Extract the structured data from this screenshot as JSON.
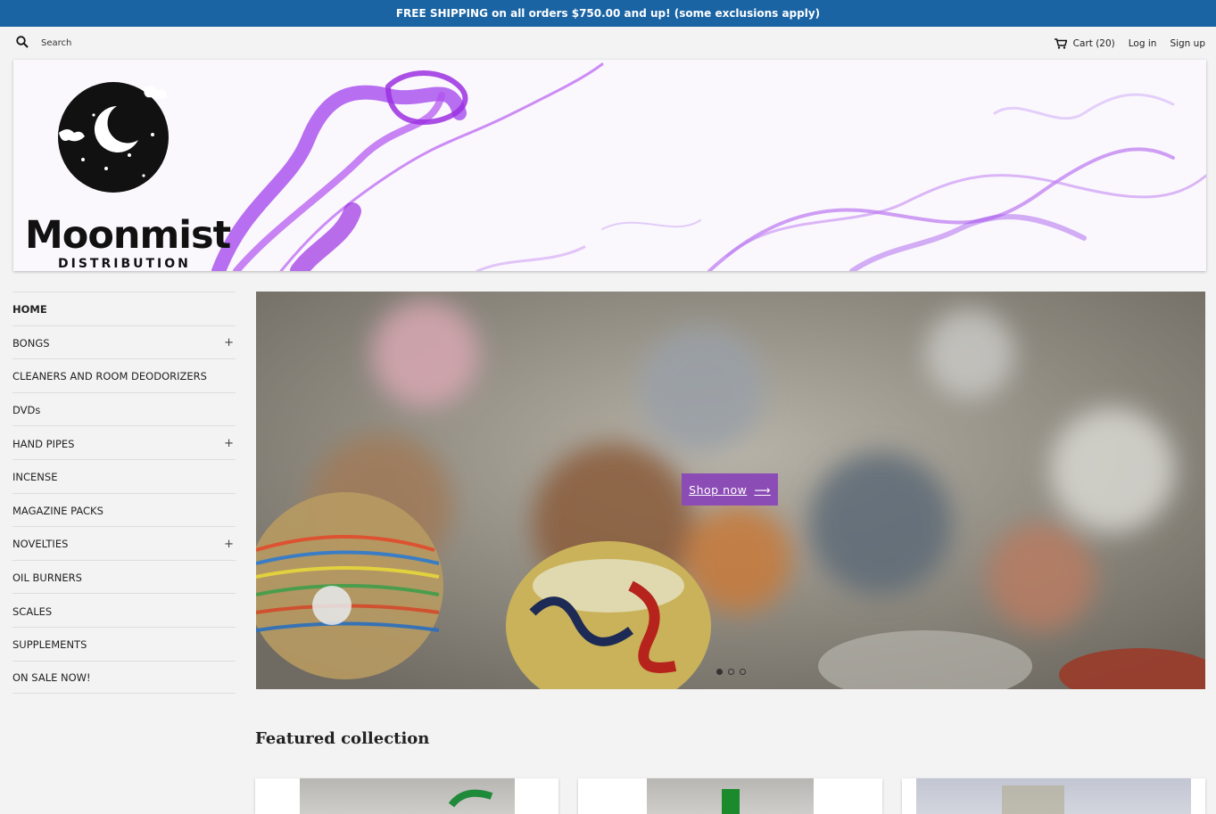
{
  "announcement": "FREE SHIPPING on all orders $750.00 and up! (some exclusions apply)",
  "search": {
    "placeholder": "Search",
    "icon": "search-icon"
  },
  "account": {
    "cart_label": "Cart (20)",
    "login": "Log in",
    "signup": "Sign up"
  },
  "brand": {
    "name": "Moonmist",
    "tagline": "DISTRIBUTION",
    "accent": "#9b30e0"
  },
  "sidebar": {
    "items": [
      {
        "label": "HOME",
        "expandable": false,
        "active": true
      },
      {
        "label": "BONGS",
        "expandable": true,
        "active": false
      },
      {
        "label": "CLEANERS AND ROOM DEODORIZERS",
        "expandable": false,
        "active": false
      },
      {
        "label": "DVDs",
        "expandable": false,
        "active": false
      },
      {
        "label": "HAND PIPES",
        "expandable": true,
        "active": false
      },
      {
        "label": "INCENSE",
        "expandable": false,
        "active": false
      },
      {
        "label": "MAGAZINE PACKS",
        "expandable": false,
        "active": false
      },
      {
        "label": "NOVELTIES",
        "expandable": true,
        "active": false
      },
      {
        "label": "OIL BURNERS",
        "expandable": false,
        "active": false
      },
      {
        "label": "SCALES",
        "expandable": false,
        "active": false
      },
      {
        "label": "SUPPLEMENTS",
        "expandable": false,
        "active": false
      },
      {
        "label": "ON SALE NOW!",
        "expandable": false,
        "active": false
      }
    ],
    "expand_symbol": "+"
  },
  "hero": {
    "button_label": "Shop now",
    "button_arrow": "⟶",
    "slide_count": 3,
    "active_slide": 1,
    "button_color": "#8c4cb5"
  },
  "featured": {
    "heading": "Featured collection"
  },
  "colors": {
    "announcement_bg": "#1a64a4",
    "page_bg": "#f3f3f3"
  }
}
